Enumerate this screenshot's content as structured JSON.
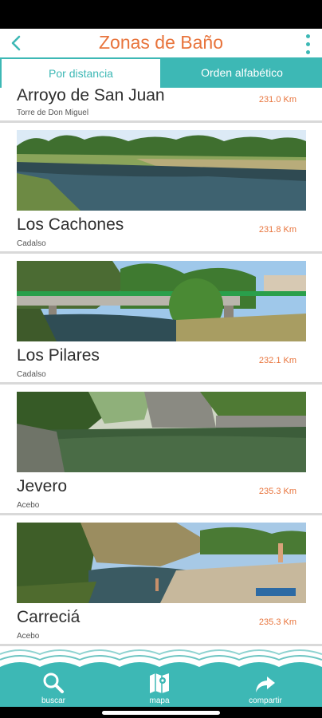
{
  "header": {
    "title": "Zonas de Baño",
    "back_icon": "chevron-left-icon",
    "menu_icon": "more-vertical-icon"
  },
  "tabs": [
    {
      "label": "Por distancia",
      "selected": true
    },
    {
      "label": "Orden alfabético",
      "selected": false
    }
  ],
  "places": [
    {
      "name": "Arroyo de San Juan",
      "town": "Torre de Don Miguel",
      "distance": "231.0 Km"
    },
    {
      "name": "Los Cachones",
      "town": "Cadalso",
      "distance": "231.8 Km"
    },
    {
      "name": "Los Pilares",
      "town": "Cadalso",
      "distance": "232.1 Km"
    },
    {
      "name": "Jevero",
      "town": "Acebo",
      "distance": "235.3 Km"
    },
    {
      "name": "Carreciá",
      "town": "Acebo",
      "distance": "235.3 Km"
    }
  ],
  "footer": {
    "search_label": "buscar",
    "map_label": "mapa",
    "share_label": "compartir"
  },
  "colors": {
    "accent": "#3db8b5",
    "title": "#e8743c",
    "distance": "#e8743c"
  }
}
